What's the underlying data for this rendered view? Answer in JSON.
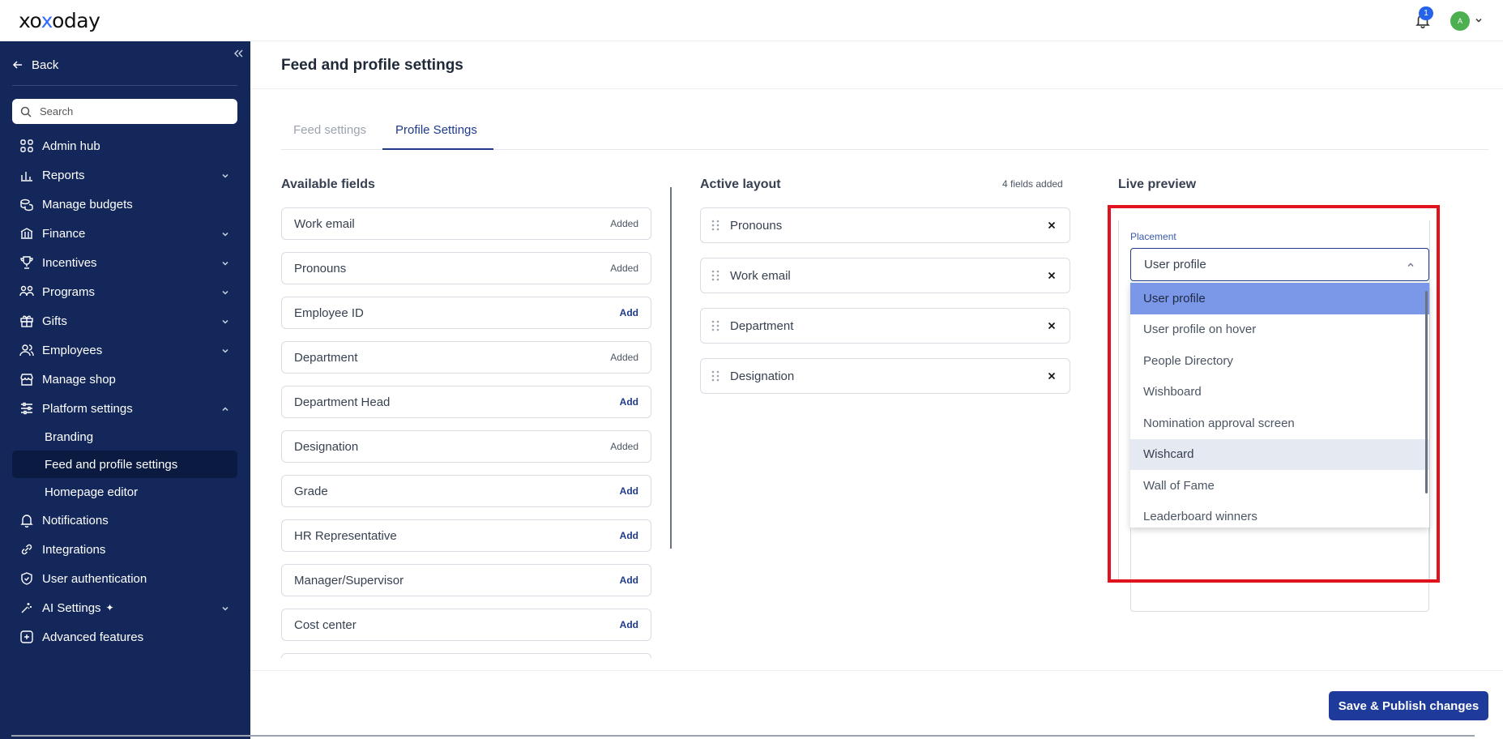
{
  "app": {
    "logo": "xoxoday",
    "notification_count": "1",
    "avatar_initial": "A"
  },
  "sidebar": {
    "back_label": "Back",
    "search_placeholder": "Search",
    "items": [
      {
        "label": "Admin hub",
        "icon": "grid-icon",
        "expandable": false
      },
      {
        "label": "Reports",
        "icon": "chart-icon",
        "expandable": true
      },
      {
        "label": "Manage budgets",
        "icon": "coins-icon",
        "expandable": false
      },
      {
        "label": "Finance",
        "icon": "bank-icon",
        "expandable": true
      },
      {
        "label": "Incentives",
        "icon": "trophy-icon",
        "expandable": true
      },
      {
        "label": "Programs",
        "icon": "programs-icon",
        "expandable": true
      },
      {
        "label": "Gifts",
        "icon": "gift-icon",
        "expandable": true
      },
      {
        "label": "Employees",
        "icon": "users-icon",
        "expandable": true
      },
      {
        "label": "Manage shop",
        "icon": "shop-icon",
        "expandable": false
      },
      {
        "label": "Platform settings",
        "icon": "sliders-icon",
        "expandable": true,
        "expanded": true
      }
    ],
    "sub_items": [
      {
        "label": "Branding",
        "active": false
      },
      {
        "label": "Feed and profile settings",
        "active": true
      },
      {
        "label": "Homepage editor",
        "active": false
      }
    ],
    "items_after": [
      {
        "label": "Notifications",
        "icon": "bell-icon",
        "expandable": false
      },
      {
        "label": "Integrations",
        "icon": "link-icon",
        "expandable": false
      },
      {
        "label": "User authentication",
        "icon": "shield-icon",
        "expandable": false
      },
      {
        "label": "AI Settings",
        "icon": "ai-icon",
        "expandable": true
      },
      {
        "label": "Advanced features",
        "icon": "plus-square-icon",
        "expandable": false
      }
    ]
  },
  "page": {
    "title": "Feed and profile settings",
    "tabs": [
      {
        "label": "Feed settings"
      },
      {
        "label": "Profile Settings"
      }
    ]
  },
  "available": {
    "title": "Available fields",
    "fields": [
      {
        "name": "Work email",
        "status": "Added"
      },
      {
        "name": "Pronouns",
        "status": "Added"
      },
      {
        "name": "Employee ID",
        "status": "Add"
      },
      {
        "name": "Department",
        "status": "Added"
      },
      {
        "name": "Department Head",
        "status": "Add"
      },
      {
        "name": "Designation",
        "status": "Added"
      },
      {
        "name": "Grade",
        "status": "Add"
      },
      {
        "name": "HR Representative",
        "status": "Add"
      },
      {
        "name": "Manager/Supervisor",
        "status": "Add"
      },
      {
        "name": "Cost center",
        "status": "Add"
      }
    ]
  },
  "active_layout": {
    "title": "Active layout",
    "count": "4 fields added",
    "items": [
      "Pronouns",
      "Work email",
      "Department",
      "Designation"
    ]
  },
  "preview": {
    "title": "Live preview",
    "placement_label": "Placement",
    "selected": "User profile",
    "options": [
      "User profile",
      "User profile on hover",
      "People Directory",
      "Wishboard",
      "Nomination approval screen",
      "Wishcard",
      "Wall of Fame",
      "Leaderboard winners"
    ]
  },
  "footer": {
    "save_label": "Save & Publish changes"
  },
  "colors": {
    "sidebar_bg": "#14275a",
    "accent": "#1e3a8a",
    "highlight_border": "#e0121d",
    "selected_option": "#7b97e8"
  }
}
